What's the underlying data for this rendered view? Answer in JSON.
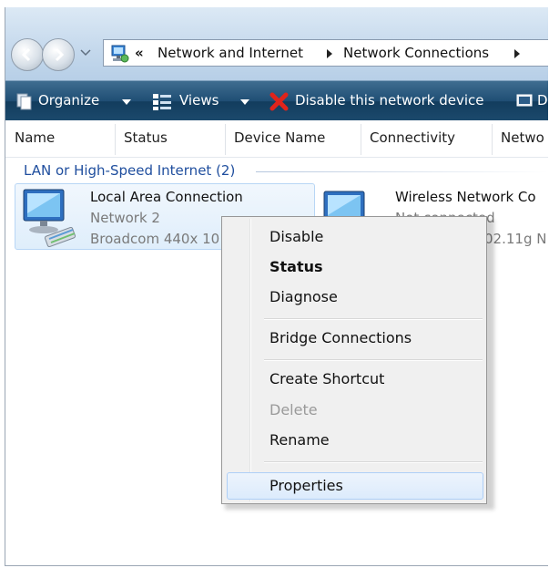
{
  "address_bar": {
    "overflow_glyph": "«",
    "breadcrumbs": [
      "Network and Internet",
      "Network Connections"
    ]
  },
  "command_bar": {
    "organize": "Organize",
    "views": "Views",
    "disable_device": "Disable this network device",
    "overflow_glyph": "D"
  },
  "columns": [
    "Name",
    "Status",
    "Device Name",
    "Connectivity",
    "Netwo"
  ],
  "group": {
    "label": "LAN or High-Speed Internet (2)"
  },
  "items": [
    {
      "name": "Local Area Connection",
      "network": "Network  2",
      "device": "Broadcom 440x 10"
    },
    {
      "name": "Wireless Network Co",
      "network": "Not connected",
      "device": "02.11g N"
    }
  ],
  "context_menu": {
    "items": [
      {
        "label": "Disable"
      },
      {
        "label": "Status"
      },
      {
        "label": "Diagnose"
      },
      {
        "label": "Bridge Connections"
      },
      {
        "label": "Create Shortcut"
      },
      {
        "label": "Delete"
      },
      {
        "label": "Rename"
      },
      {
        "label": "Properties"
      }
    ]
  },
  "colors": {
    "command_bar": "#1f4e74",
    "group_text": "#1f4e9e",
    "selection_border": "#b8d6f5",
    "menu_background": "#f0f0f0"
  },
  "icons": [
    "back-arrow-icon",
    "forward-arrow-icon",
    "network-folder-icon",
    "organize-icon",
    "views-icon",
    "disable-x-icon",
    "network-adapter-icon"
  ]
}
